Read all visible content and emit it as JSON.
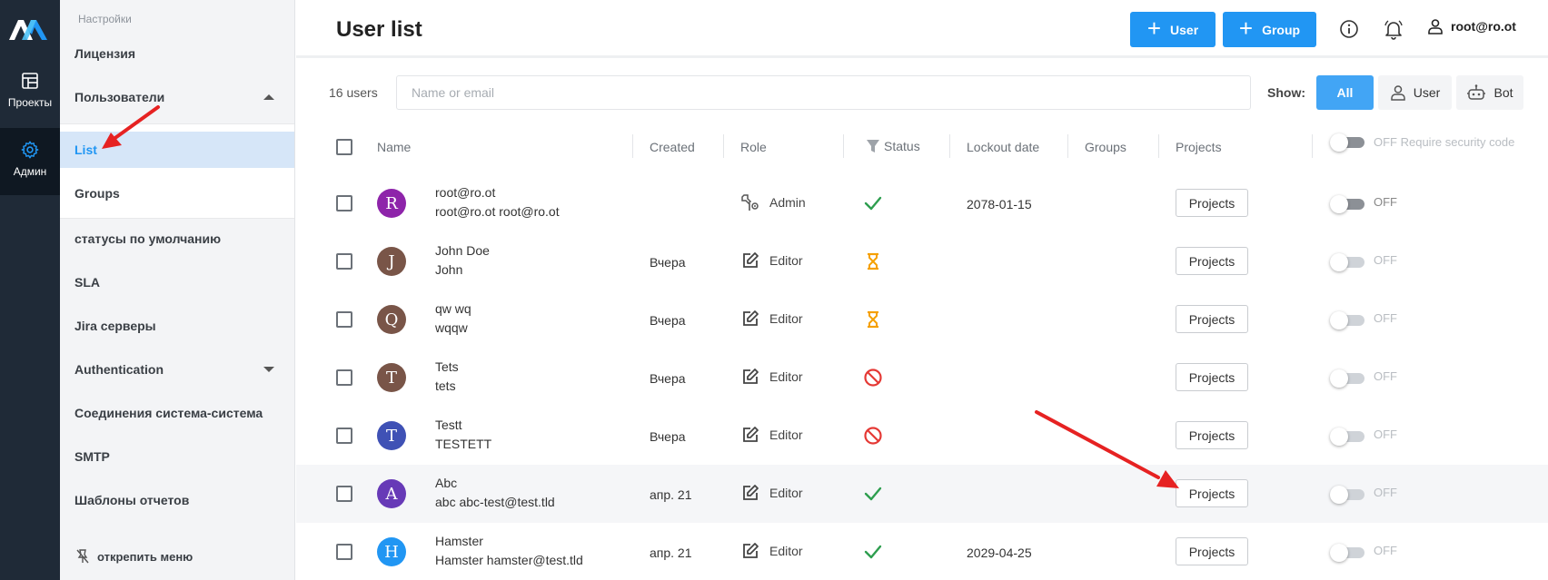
{
  "rail": {
    "items": [
      {
        "label": "Проекты",
        "icon": "dashboard-icon"
      },
      {
        "label": "Админ",
        "icon": "gear-icon"
      }
    ]
  },
  "sidebar": {
    "header": "Настройки",
    "items": [
      {
        "label": "Лицензия"
      },
      {
        "label": "Пользователи",
        "expanded": true
      },
      {
        "label": "List",
        "active": true
      },
      {
        "label": "Groups"
      },
      {
        "label": "статусы по умолчанию"
      },
      {
        "label": "SLA"
      },
      {
        "label": "Jira серверы"
      },
      {
        "label": "Authentication",
        "expanded": false
      },
      {
        "label": "Соединения система-система"
      },
      {
        "label": "SMTP"
      },
      {
        "label": "Шаблоны отчетов"
      }
    ],
    "unpin_label": "открепить меню"
  },
  "header": {
    "title": "User list",
    "add_user_label": "User",
    "add_group_label": "Group",
    "current_user": "root@ro.ot"
  },
  "toolbar": {
    "count": "16 users",
    "search_placeholder": "Name or email",
    "show_label": "Show:",
    "filters": [
      "All",
      "User",
      "Bot"
    ],
    "active_filter": "All"
  },
  "table": {
    "columns": [
      "Name",
      "Created",
      "Role",
      "Status",
      "Lockout date",
      "Groups",
      "Projects"
    ],
    "security_toggle_label": "OFF Require security code",
    "rows": [
      {
        "initial": "R",
        "avatar_color": "#8e24aa",
        "name": "root@ro.ot",
        "sub": "root@ro.ot root@ro.ot",
        "created": "",
        "role": "Admin",
        "role_icon": "admin-tools-icon",
        "status": "active",
        "lockout": "2078-01-15",
        "projects_label": "Projects",
        "toggle": "OFF"
      },
      {
        "initial": "J",
        "avatar_color": "#795548",
        "name": "John Doe",
        "sub": "John",
        "created": "Вчера",
        "role": "Editor",
        "role_icon": "edit-icon",
        "status": "pending",
        "lockout": "",
        "projects_label": "Projects",
        "toggle": "OFF"
      },
      {
        "initial": "Q",
        "avatar_color": "#795548",
        "name": "qw wq",
        "sub": "wqqw",
        "created": "Вчера",
        "role": "Editor",
        "role_icon": "edit-icon",
        "status": "pending",
        "lockout": "",
        "projects_label": "Projects",
        "toggle": "OFF"
      },
      {
        "initial": "T",
        "avatar_color": "#795548",
        "name": "Tets",
        "sub": "tets",
        "created": "Вчера",
        "role": "Editor",
        "role_icon": "edit-icon",
        "status": "blocked",
        "lockout": "",
        "projects_label": "Projects",
        "toggle": "OFF"
      },
      {
        "initial": "T",
        "avatar_color": "#3f51b5",
        "name": "Testt",
        "sub": "TESTETT",
        "created": "Вчера",
        "role": "Editor",
        "role_icon": "edit-icon",
        "status": "blocked",
        "lockout": "",
        "projects_label": "Projects",
        "toggle": "OFF"
      },
      {
        "initial": "A",
        "avatar_color": "#673ab7",
        "name": "Abc",
        "sub": "abc abc-test@test.tld",
        "created": "апр. 21",
        "role": "Editor",
        "role_icon": "edit-icon",
        "status": "active",
        "lockout": "",
        "projects_label": "Projects",
        "toggle": "OFF"
      },
      {
        "initial": "H",
        "avatar_color": "#2196f3",
        "name": "Hamster",
        "sub": "Hamster hamster@test.tld",
        "created": "апр. 21",
        "role": "Editor",
        "role_icon": "edit-icon",
        "status": "active",
        "lockout": "2029-04-25",
        "projects_label": "Projects",
        "toggle": "OFF"
      }
    ]
  },
  "colors": {
    "accent": "#2196f3",
    "rail_bg": "#1f2a37",
    "status_ok": "#2e9e4f",
    "status_pending": "#f5a000",
    "status_blocked": "#e53935",
    "annotation_arrow": "#e62222"
  }
}
